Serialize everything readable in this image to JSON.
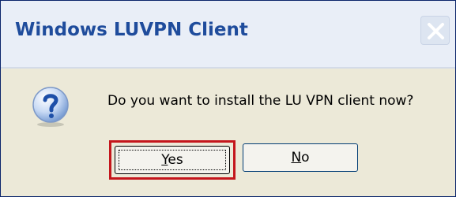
{
  "window": {
    "title": "Windows LUVPN Client"
  },
  "dialog": {
    "icon": "question-icon",
    "message": "Do you want to install the LU VPN client now?"
  },
  "buttons": {
    "yes": {
      "accelerator": "Y",
      "rest": "es"
    },
    "no": {
      "accelerator": "N",
      "rest": "o"
    }
  },
  "colors": {
    "title_text": "#1f4c9c",
    "dialog_bg": "#ece9d8",
    "highlight_box": "#c4161c",
    "question_icon": "#2b5fb8"
  }
}
